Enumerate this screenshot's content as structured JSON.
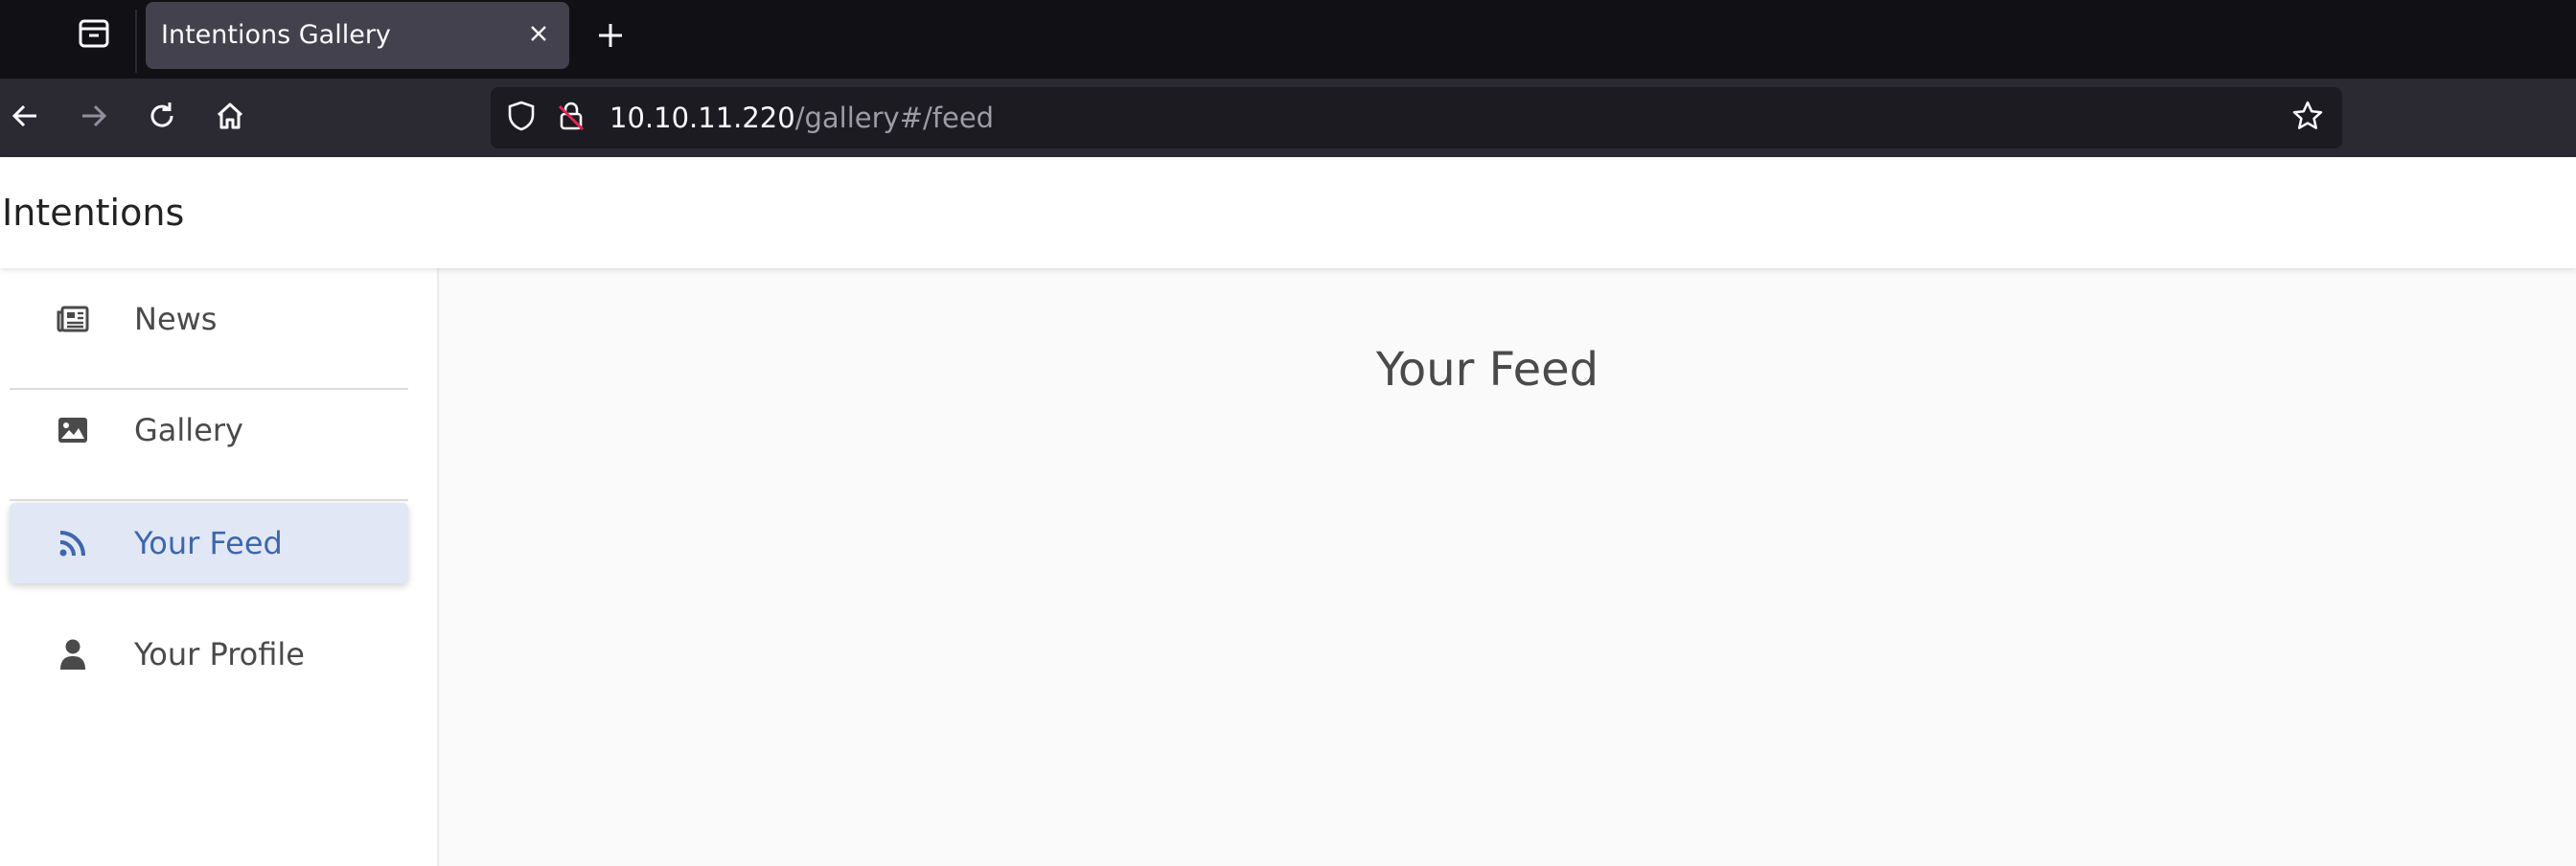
{
  "browser": {
    "tab": {
      "title": "Intentions Gallery"
    },
    "url": {
      "host": "10.10.11.220",
      "path": "/gallery#/feed"
    },
    "icons": {
      "tab_list": "tab-list-icon",
      "close": "close-icon",
      "new_tab": "plus-icon",
      "back": "arrow-left-icon",
      "forward": "arrow-right-icon",
      "reload": "reload-icon",
      "home": "home-icon",
      "shield": "shield-icon",
      "insecure_lock": "insecure-lock-icon",
      "bookmark": "star-icon"
    }
  },
  "app": {
    "title": "Intentions"
  },
  "sidebar": {
    "items": [
      {
        "label": "News",
        "icon": "newspaper-icon",
        "active": false
      },
      {
        "label": "Gallery",
        "icon": "image-icon",
        "active": false
      },
      {
        "label": "Your Feed",
        "icon": "rss-icon",
        "active": true
      },
      {
        "label": "Your Profile",
        "icon": "user-icon",
        "active": false
      }
    ]
  },
  "main": {
    "title": "Your Feed"
  },
  "colors": {
    "tabstrip_bg": "#101015",
    "navbar_bg": "#2b2a33",
    "active_tab_bg": "#42414d",
    "urlbar_bg": "#1c1b22",
    "accent": "#3d67ad",
    "active_item_bg": "#e1e7f5",
    "content_bg": "#fafafa"
  }
}
